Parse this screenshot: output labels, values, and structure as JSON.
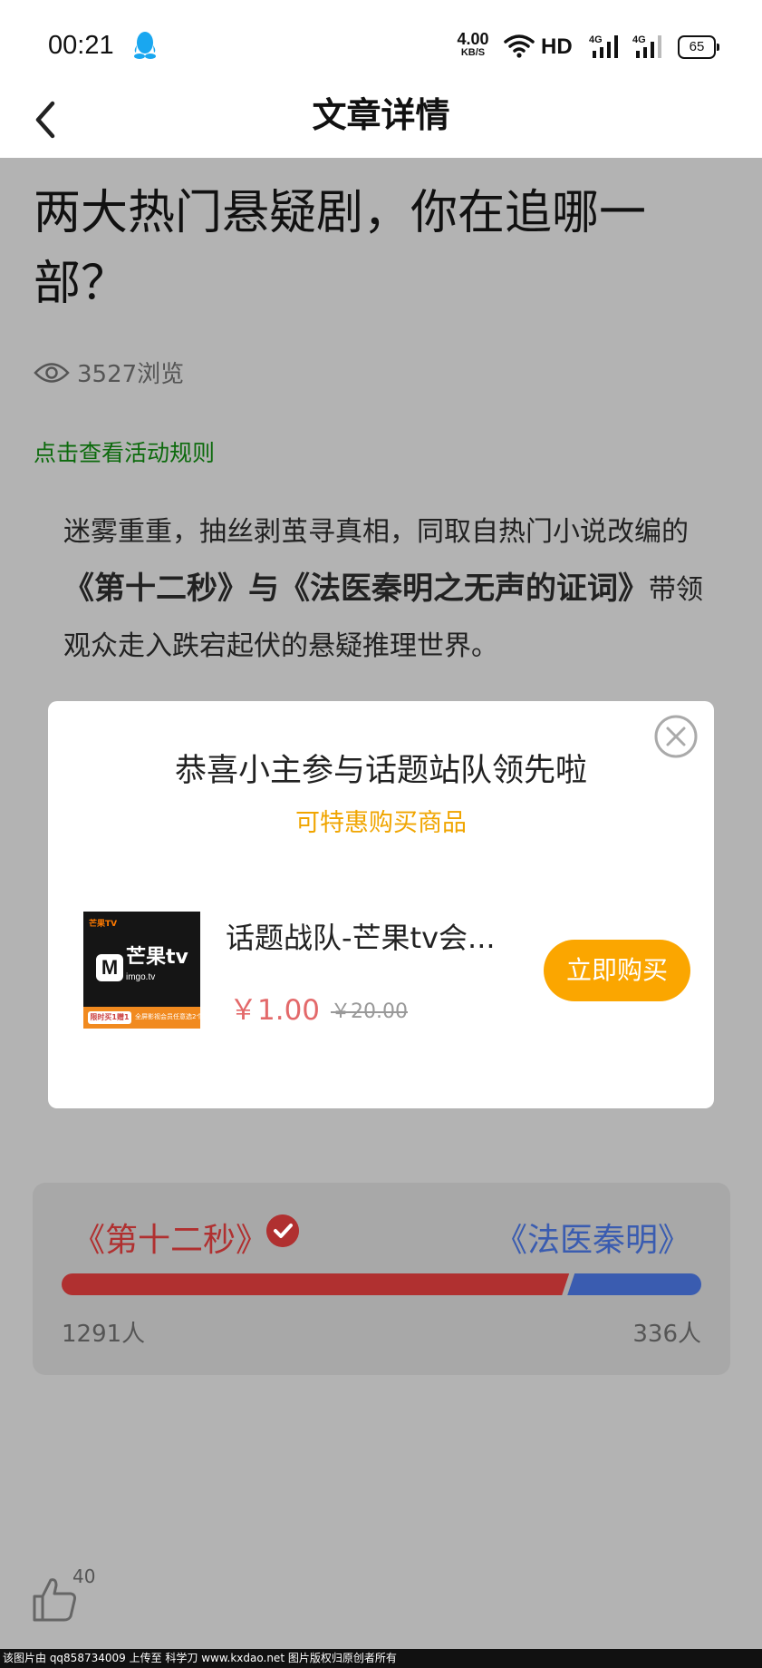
{
  "status_bar": {
    "time": "00:21",
    "net_speed_value": "4.00",
    "net_speed_unit": "KB/S",
    "hd_label": "HD",
    "signal_1_label": "4G",
    "signal_2_label": "4G",
    "battery": "65",
    "icons": [
      "qq-penguin-icon",
      "wifi-icon",
      "signal-icon",
      "battery-icon"
    ]
  },
  "nav": {
    "title": "文章详情",
    "back_icon": "chevron-left-icon"
  },
  "article": {
    "title": "两大热门悬疑剧，你在追哪一部？",
    "views": "3527浏览",
    "rules_link": "点击查看活动规则",
    "body_part1": "迷雾重重，抽丝剥茧寻真相，同取自热门小说改编的",
    "show_a_full": "《第十二秒》",
    "connector": "与",
    "show_b_full": "《法医秦明之无声的证词》",
    "body_part2": "带领观众走入跌宕起伏的悬疑推理世界。"
  },
  "vote": {
    "team_a": "《第十二秒》",
    "team_b": "《法医秦明》",
    "count_a": "1291人",
    "count_b": "336人",
    "share_a": 0.7935,
    "colors": {
      "team_a": "#b03030",
      "team_b": "#3a5cb0"
    }
  },
  "like": {
    "count": "40",
    "icon": "thumbs-up-icon"
  },
  "footer": {
    "text": "该图片由 qq858734009 上传至 科学刀 www.kxdao.net 图片版权归原创者所有"
  },
  "modal": {
    "title": "恭喜小主参与话题站队领先啦",
    "subtitle": "可特惠购买商品",
    "product_name": "话题战队-芒果tv会...",
    "price": "￥1.00",
    "original_price": "￥20.00",
    "buy_button": "立即购买",
    "close_icon": "close-circle-icon",
    "product_image": {
      "top_text": "芒果TV",
      "logo_text": "芒果tv",
      "logo_sub": "imgo.tv",
      "band_badge": "限时买1赠1",
      "band_text": "全屏影视会员任意选2个月"
    },
    "colors": {
      "subtitle": "#f0a500",
      "price": "#e3696a",
      "button": "#fba600"
    }
  }
}
